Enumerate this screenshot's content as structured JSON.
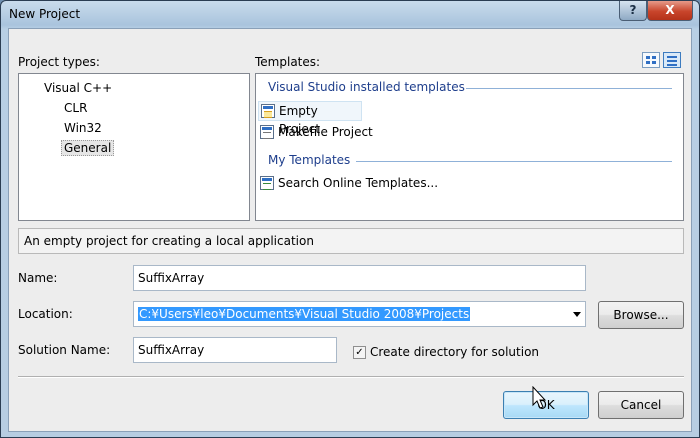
{
  "window": {
    "title": "New Project",
    "help_glyph": "?",
    "close_glyph": "X"
  },
  "project_types": {
    "label": "Project types:",
    "items": [
      {
        "label": "Visual C++",
        "level": 0,
        "selected": false
      },
      {
        "label": "CLR",
        "level": 1,
        "selected": false
      },
      {
        "label": "Win32",
        "level": 1,
        "selected": false
      },
      {
        "label": "General",
        "level": 1,
        "selected": true
      }
    ]
  },
  "templates": {
    "label": "Templates:",
    "groups": [
      {
        "heading": "Visual Studio installed templates",
        "items": [
          {
            "label": "Empty Project",
            "icon": "empty-project-icon",
            "selected": true
          },
          {
            "label": "Makefile Project",
            "icon": "makefile-project-icon",
            "selected": false
          }
        ]
      },
      {
        "heading": "My Templates",
        "items": [
          {
            "label": "Search Online Templates...",
            "icon": "search-online-templates-icon",
            "selected": false
          }
        ]
      }
    ],
    "view": {
      "icons": [
        "large-icons-view-icon",
        "small-icons-view-icon"
      ],
      "active": "small-icons-view-icon"
    }
  },
  "description": "An empty project for creating a local application",
  "form": {
    "name_label": "Name:",
    "name_value": "SuffixArray",
    "location_label": "Location:",
    "location_value": "C:¥Users¥leo¥Documents¥Visual Studio 2008¥Projects",
    "browse_label": "Browse...",
    "solution_name_label": "Solution Name:",
    "solution_name_value": "SuffixArray",
    "create_directory_label": "Create directory for solution",
    "create_directory_checked": true,
    "check_glyph": "✓"
  },
  "buttons": {
    "ok": "OK",
    "cancel": "Cancel"
  },
  "colors": {
    "group_heading": "#1e3e8c",
    "selection_highlight": "#3399ff",
    "default_button_border": "#3c7fb1"
  }
}
